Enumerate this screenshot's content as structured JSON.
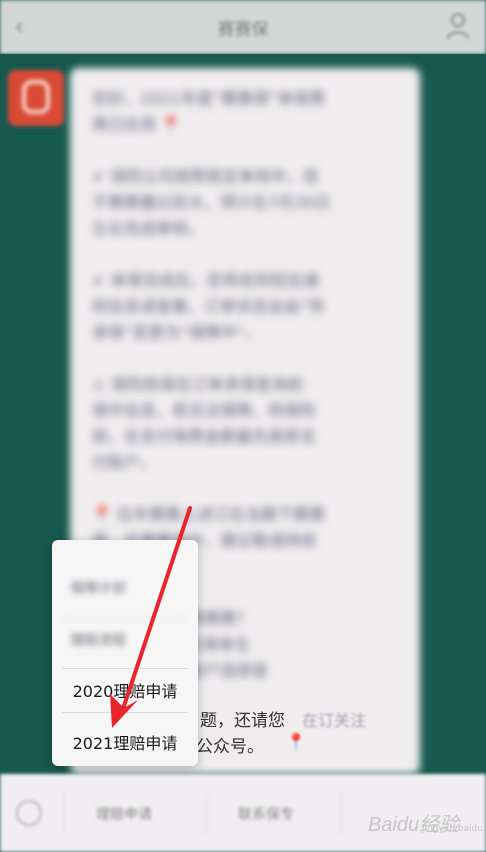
{
  "nav": {
    "title": "赛赛保",
    "back_glyph": "‹"
  },
  "bubble": {
    "paragraphs": [
      [
        "您好，2021年度“赛赛保”单保费",
        "再已应用 📍"
      ],
      [
        "✔ 保险公司按照核定单规中，但",
        "于赛赛量比较大，预计在7月30日",
        "左右完成审核。"
      ],
      [
        "✔ 单保完成后，您将收到短信通",
        "知信息请查看，订单状态会由“待",
        "承保”变更为“保障中”。"
      ],
      [
        "⚠ 保险核保在订单承保查询前",
        "保中信息，若无法保障，则保险",
        "核，在支付保费金额最先按原支",
        "付账户。"
      ],
      [
        "📍 往年赛赛上述订在当期下赛赛",
        "保，自赛赛保中，建议敬请持续",
        "查询。"
      ],
      [
        "         年保单生效已赛赛赛？",
        "         于7月12日之后保单生",
        "         户认证请前往账户选择查",
        "         询。"
      ],
      [
        "",
        ""
      ]
    ]
  },
  "popup": {
    "blurred_items": [
      "保障计划",
      "理赔流程"
    ],
    "items": [
      "2020理赔申请",
      "2021理赔申请"
    ]
  },
  "behind_text": {
    "line1": "题，还请您",
    "line1_fade": "在订关注",
    "line2": "公众号。",
    "line2_fade": "📍"
  },
  "bottom": {
    "menu1": "理赔申请",
    "menu2": "联系保专"
  },
  "watermark": {
    "brand": "Bai",
    "icon": "du",
    "cn": "经验",
    "sub": "jingyan.baidu.com"
  },
  "colors": {
    "chat_bg": "#17594f",
    "arrow": "#e8252a",
    "popup_bg": "#f7f6f6"
  }
}
